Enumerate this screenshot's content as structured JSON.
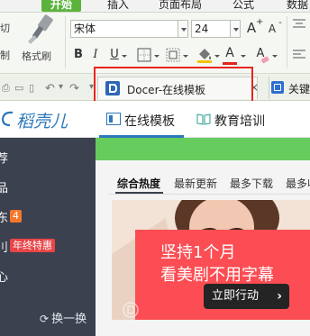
{
  "menu": {
    "tabs": [
      {
        "label": "开始",
        "active": true
      },
      {
        "label": "插入",
        "active": false
      },
      {
        "label": "页面布局",
        "active": false
      },
      {
        "label": "公式",
        "active": false
      },
      {
        "label": "数据",
        "active": false
      }
    ]
  },
  "ribbon": {
    "cut_label": "剪切",
    "copy_label": "复制",
    "format_painter_label": "格式刷",
    "font_name": "宋体",
    "font_size": "24",
    "bold": "B",
    "italic": "I",
    "underline": "U",
    "font_color_glyph": "A",
    "grow_font": "A",
    "shrink_font": "A",
    "clear_format_glyph": "A"
  },
  "tabbar": {
    "active_tab_label": "Docer-在线模板",
    "close_glyph": "×",
    "other_tab_label": "关键"
  },
  "docer": {
    "brand": "稻壳儿",
    "tabs": [
      {
        "label": "在线模板",
        "active": true
      },
      {
        "label": "教育培训",
        "active": false
      }
    ]
  },
  "sidebar": {
    "items": [
      {
        "label": "荐"
      },
      {
        "label": "品"
      },
      {
        "label": "东",
        "badge": "4"
      },
      {
        "label": "刂",
        "tag": "年终特惠"
      },
      {
        "label": "心"
      }
    ],
    "refresh_label": "换一换"
  },
  "filters": {
    "tabs": [
      {
        "label": "综合热度",
        "active": true
      },
      {
        "label": "最新更新",
        "active": false
      },
      {
        "label": "最多下载",
        "active": false
      },
      {
        "label": "最多收",
        "active": false
      }
    ]
  },
  "ad": {
    "line1": "坚持1个月",
    "line2": "看美剧不用字幕",
    "button_label": "立即行动",
    "button_chevron": "›"
  },
  "colors": {
    "menu_active": "#5cb33c",
    "highlight_box": "#e8261f",
    "brand_blue": "#2c78bd",
    "sidebar_bg": "#3c4150",
    "green_banner": "#66cc5e",
    "ad_red": "#fb4d53",
    "badge_orange": "#f5782a"
  }
}
